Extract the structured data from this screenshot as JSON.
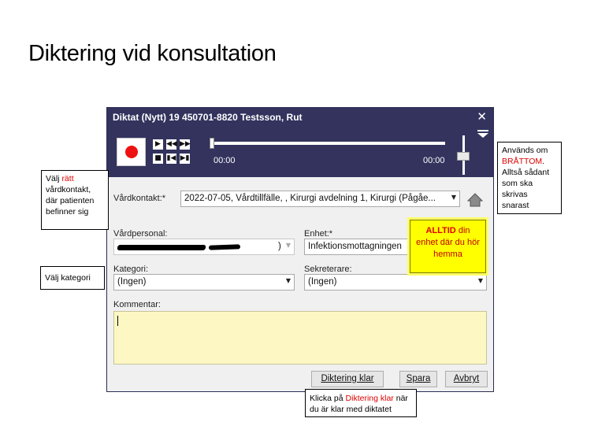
{
  "slide": {
    "title": "Diktering vid konsultation"
  },
  "dialog": {
    "title": "Diktat (Nytt) 19 450701-8820 Testsson, Rut",
    "close": "✕",
    "player": {
      "time_start": "00:00",
      "time_end": "00:00",
      "progress": 0
    },
    "vardkontakt": {
      "label": "Vårdkontakt:*",
      "value": "2022-07-05, Vårdtillfälle, , Kirurgi avdelning 1, Kirurgi (Pågåe..."
    },
    "vardpersonal": {
      "label": "Vårdpersonal:",
      "value_tail": ")"
    },
    "enhet": {
      "label": "Enhet:*",
      "value": "Infektionsmottagningen"
    },
    "kategori": {
      "label": "Kategori:",
      "value": "(Ingen)"
    },
    "sekreterare": {
      "label": "Sekreterare:",
      "value": "(Ingen)"
    },
    "kommentar": {
      "label": "Kommentar:",
      "value": ""
    },
    "buttons": {
      "klar": "Diktering klar",
      "spara": "Spara",
      "avbryt": "Avbryt"
    }
  },
  "callouts": {
    "vardkontakt": {
      "pre": "Välj ",
      "red": "rätt",
      "post": "vårdkontakt, där patienten befinner sig"
    },
    "kategori": "Välj kategori",
    "bratom": {
      "pre": "Används om",
      "red": "BRÅTTOM",
      "post1": ".",
      "post2": "Alltså sådant som ska skrivas snarast"
    },
    "enhet": {
      "bold": "ALLTID",
      "rest": " din enhet där du hör hemma"
    },
    "klar": {
      "pre": "Klicka på ",
      "red": "Diktering klar",
      "post": " när du är klar med diktatet"
    }
  },
  "colors": {
    "titlebar": "#33335e",
    "record": "#ee1111",
    "comment_bg": "#fdf7c4",
    "highlight": "#ffff00"
  }
}
